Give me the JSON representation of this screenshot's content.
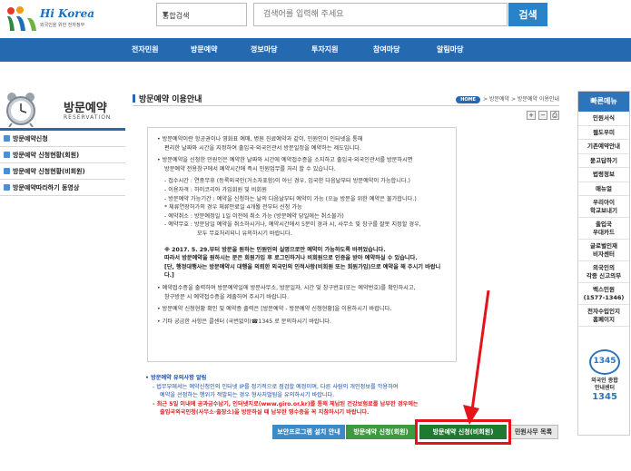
{
  "header": {
    "logo_text": "Hi Korea",
    "logo_sub": "외국인을 위한 전자정부",
    "search_category": "통합검색",
    "search_placeholder": "검색어를 입력해 주세요",
    "search_button": "검색"
  },
  "gnb": [
    "전자민원",
    "방문예약",
    "정보마당",
    "투자지원",
    "참여마당",
    "알림마당"
  ],
  "lnb": {
    "title": "방문예약",
    "subtitle": "RESERVATION",
    "items": [
      "방문예약신청",
      "방문예약 신청현황(회원)",
      "방문예약 신청현황(비회원)",
      "방문예약따라하기 동영상"
    ]
  },
  "main": {
    "title": "방문예약 이용안내",
    "breadcrumb": {
      "home": "HOME",
      "path": "> 방문예약 > 방문예약 이용안내"
    },
    "tools": [
      "+",
      "−"
    ],
    "intro": [
      "방문예약이란 항공권이나 영화표 예매, 병원 진료예약과 같이, 민원인이 인터넷을 통해",
      "편리한 날짜와 시간을 지정하여 출입국·외국인관서 방문일정을 예약하는 제도입니다."
    ],
    "intro2": [
      "방문예약을 신청한 민원인은 예약한 날짜와 시간에 예약접수증을 소지하고 출입국·외국인관서를 방문하시면",
      "방문예약 전용창구에서 예약시간에 즉시 민원업무를 처리 할 수 있습니다."
    ],
    "details": [
      "- 접수시간 : 연중무휴 (등록외국인(거소자포함)이 아닌 경우, 입국한 다음날부터 방문예약이 가능합니다.)",
      "- 이용자격 : 하이코리아 가입회원 및 비회원",
      "- 방문예약 가능기간 : 예약을 신청하는 날의 다음날부터 예약이 가능 (오늘 방문을 위한 예약은 불가합니다.)",
      "* 체류연장허가의 경우 체류만료일 4개월 전부터 신청 가능",
      "- 예약취소 : 방문예정일 1일 이전에 취소 가능 (방문예약 당일에는 취소불가)",
      "- 예약무효 : 방문당일 예약을 취소하시거나, 예약시간에서 5분이 경과 시, 사무소 및 창구를 잘못 지정할 경우,",
      "모두 무효처리되니 유의하시기 바랍니다."
    ],
    "bold_notice": [
      "※ 2017. 5. 29.부터 방문을 원하는 민원인의 실명으로만 예약이 가능하도록 바뀌었습니다.",
      "따라서 방문예약을 원하시는 분은 회원가입 후 로그인하거나 비회원으로 인증을 받아 예약하실 수 있습니다.",
      "[단, 행정대행사는 방문예약시 대행을 의뢰한 외국인의 인적사항(비회원 또는 회원가입)으로 예약을 해 주시기 바랍니다.]"
    ],
    "print_notes": [
      "예약접수증을 출력하여 방문예약일에 방문사무소, 방문일자, 시간 및 창구번호(또는 예약번호)를 확인하시고,",
      "창구방문 시 예약접수증을 제출하여 주시기 바랍니다."
    ],
    "confirm_note": "방문예약 신청현황 확인 및 예약증 출력은 [방문예약 - 방문예약 신청현황]을 이용하시기 바랍니다.",
    "contact_note": "기타 궁금한 사항은 콜센터 (국번없이)☎1345 로 문의하시기 바랍니다.",
    "caution": {
      "head": "방문예약 유의사항 알림",
      "lines": [
        "- 법무부에서는 예약신청인의 인터넷 IP를 정기적으로 점검할 예정이며, 다른 사람의 개인정보를 악용하여",
        "예약을 선점하는 행위가 적발되는 경우 형사처벌됨을 유의하시기 바랍니다."
      ],
      "red_lines": [
        "- 최근 5일 이내에 공과금수납기, 인터넷지로(www.giro.or.kr)를 통해 체납된 건강보험료를 납부한 경우에는",
        "출입국외국인청(사무소·출장소)을 방문하실 때 납부한 영수증을 꼭 지참하시기 바랍니다."
      ]
    },
    "buttons": {
      "security": "보안프로그램 설치 안내",
      "member": "방문예약 신청(회원)",
      "nonmember": "방문예약 신청(비회원)",
      "list": "민원사무 목록"
    }
  },
  "quick": {
    "head": "빠른메뉴",
    "items": [
      "민원서식",
      "웹도우미",
      "기존예약안내",
      "묻고답하기",
      "법령정보",
      "매뉴얼",
      "우리아이\n학교보내기",
      "출입국\n우대카드",
      "글로벌인재\n비자센터",
      "외국인의\n각종 신고의무",
      "백스민원\n(1577-1346)",
      "전자수입인지\n홈페이지"
    ],
    "badge_number": "1345",
    "badge_text": "외국인 종합\n안내센터",
    "badge_big": "1345"
  },
  "colors": {
    "brand_blue": "#2569b1",
    "green": "#3d9a40",
    "dark_green": "#1f7a31",
    "red": "#e3141b"
  }
}
